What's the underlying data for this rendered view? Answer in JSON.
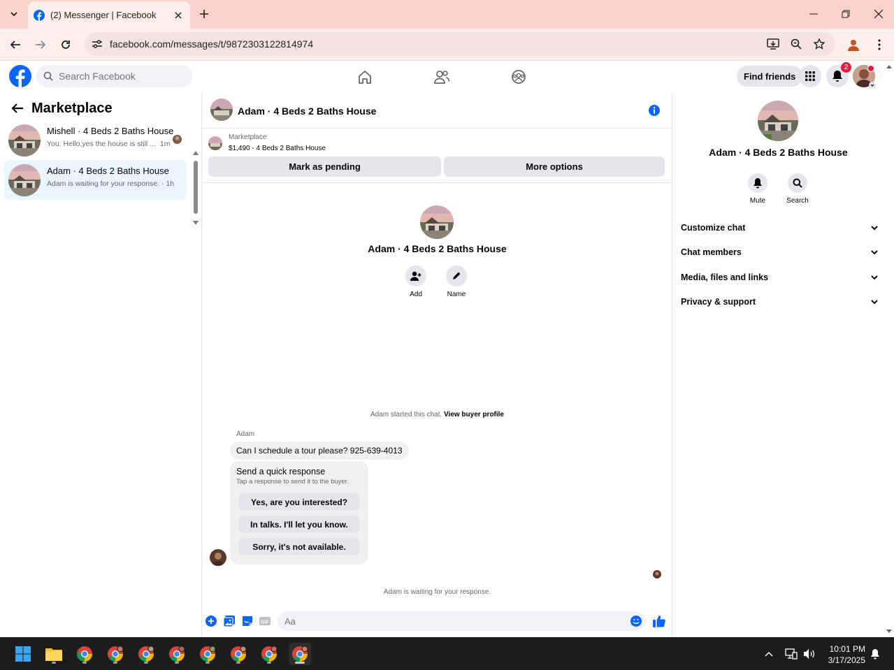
{
  "browser": {
    "tab_title": "(2) Messenger | Facebook",
    "url": "facebook.com/messages/t/9872303122814974"
  },
  "fb": {
    "search_placeholder": "Search Facebook",
    "find_friends": "Find friends",
    "notification_count": "2",
    "brand_color": "#0866ff"
  },
  "marketplace": {
    "title": "Marketplace",
    "conversations": [
      {
        "title": "Mishell · 4 Beds 2 Baths House",
        "preview": "You: Hello,yes the house is still ...",
        "time": "1m",
        "selected": false
      },
      {
        "title": "Adam · 4 Beds 2 Baths House",
        "preview": "Adam is waiting for your response.",
        "time": "1h",
        "selected": true
      }
    ]
  },
  "chat": {
    "title": "Adam · 4 Beds 2 Baths House",
    "listing_source": "Marketplace",
    "listing_price": "$1,490 - 4 Beds 2 Baths House",
    "mark_pending": "Mark as pending",
    "more_options": "More options",
    "center_title": "Adam · 4 Beds 2 Baths House",
    "add_label": "Add",
    "name_label": "Name",
    "started_text": "Adam started this chat.",
    "view_buyer": "View buyer profile",
    "sender": "Adam",
    "message": "Can I schedule a tour please? 925-639-4013",
    "quick_title": "Send a quick response",
    "quick_sub": "Tap a response to send it to the buyer.",
    "quick_responses": [
      "Yes, are you interested?",
      "In talks. I'll let you know.",
      "Sorry, it's not available."
    ],
    "waiting": "Adam is waiting for your response.",
    "input_placeholder": "Aa"
  },
  "right": {
    "title": "Adam · 4 Beds 2 Baths House",
    "mute": "Mute",
    "search": "Search",
    "sections": [
      "Customize chat",
      "Chat members",
      "Media, files and links",
      "Privacy & support"
    ]
  },
  "taskbar": {
    "time": "10:01 PM",
    "date": "3/17/2025"
  }
}
